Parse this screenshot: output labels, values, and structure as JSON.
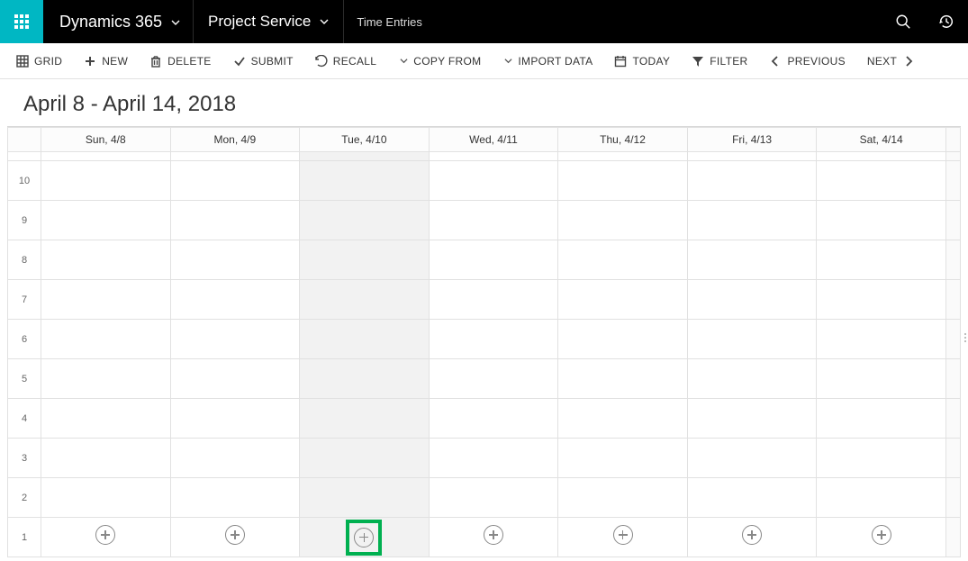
{
  "topbar": {
    "app_name": "Dynamics 365",
    "module": "Project Service",
    "crumb": "Time Entries"
  },
  "commands": {
    "grid": "GRID",
    "new": "NEW",
    "delete": "DELETE",
    "submit": "SUBMIT",
    "recall": "RECALL",
    "copy_from": "COPY FROM",
    "import_data": "IMPORT DATA",
    "today": "TODAY",
    "filter": "FILTER",
    "previous": "PREVIOUS",
    "next": "NEXT"
  },
  "title": "April 8 - April 14, 2018",
  "days": [
    "Sun, 4/8",
    "Mon, 4/9",
    "Tue, 4/10",
    "Wed, 4/11",
    "Thu, 4/12",
    "Fri, 4/13",
    "Sat, 4/14"
  ],
  "hours": [
    "10",
    "9",
    "8",
    "7",
    "6",
    "5",
    "4",
    "3",
    "2",
    "1"
  ],
  "selected_day_index": 2,
  "highlight_add_index": 2
}
